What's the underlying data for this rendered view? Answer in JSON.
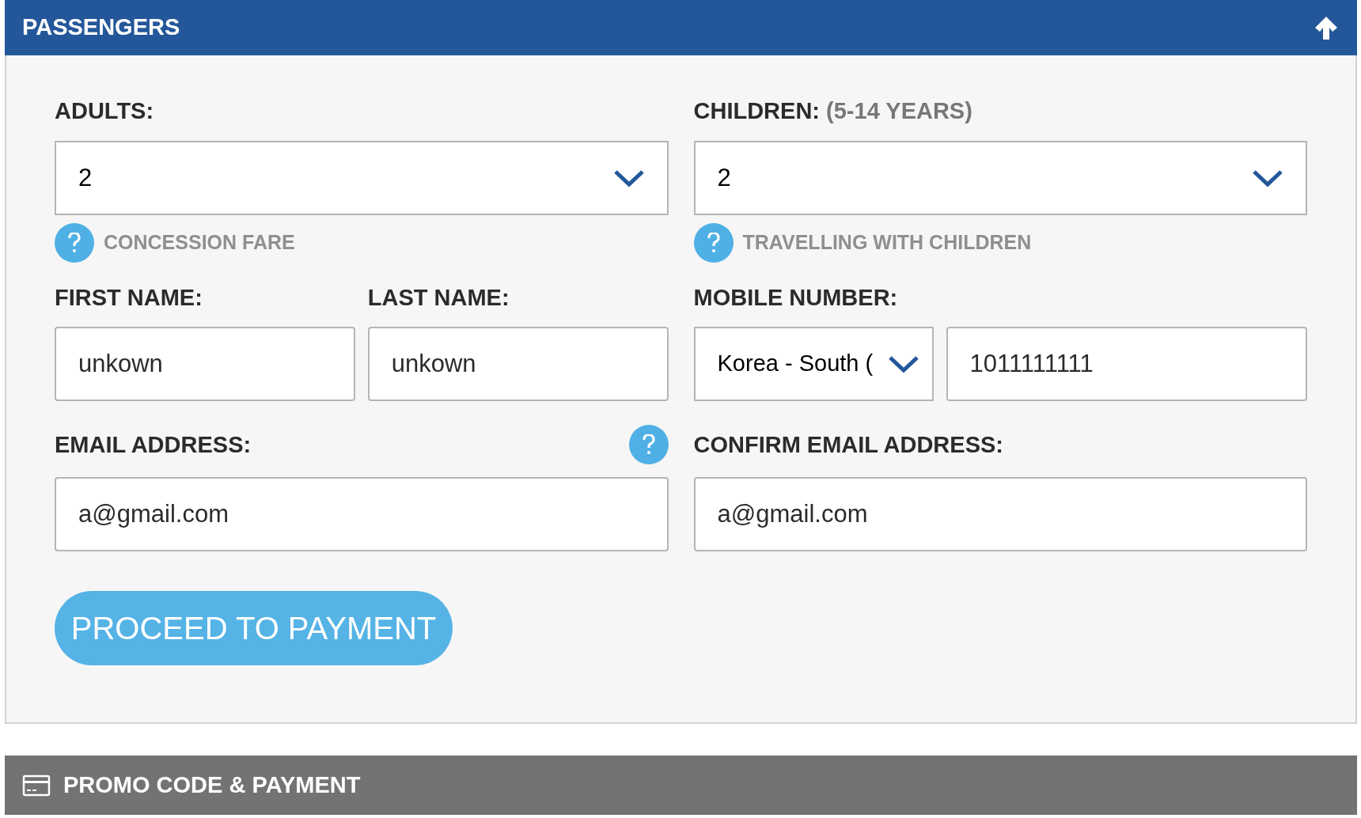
{
  "passengers_section": {
    "title": "PASSENGERS",
    "expanded": true,
    "adults": {
      "label": "ADULTS:",
      "value": "2",
      "help": "CONCESSION FARE"
    },
    "children": {
      "label": "CHILDREN:",
      "note": "(5-14 YEARS)",
      "value": "2",
      "help": "TRAVELLING WITH CHILDREN"
    },
    "first_name": {
      "label": "FIRST NAME:",
      "value": "unkown"
    },
    "last_name": {
      "label": "LAST NAME:",
      "value": "unkown"
    },
    "mobile_number": {
      "label": "MOBILE NUMBER:",
      "country": "Korea - South (",
      "value": "1011111111"
    },
    "email": {
      "label": "EMAIL ADDRESS:",
      "value": "a@gmail.com"
    },
    "confirm_email": {
      "label": "CONFIRM EMAIL ADDRESS:",
      "value": "a@gmail.com"
    },
    "proceed_button": "PROCEED TO PAYMENT"
  },
  "promo_section": {
    "title": "PROMO CODE & PAYMENT"
  }
}
